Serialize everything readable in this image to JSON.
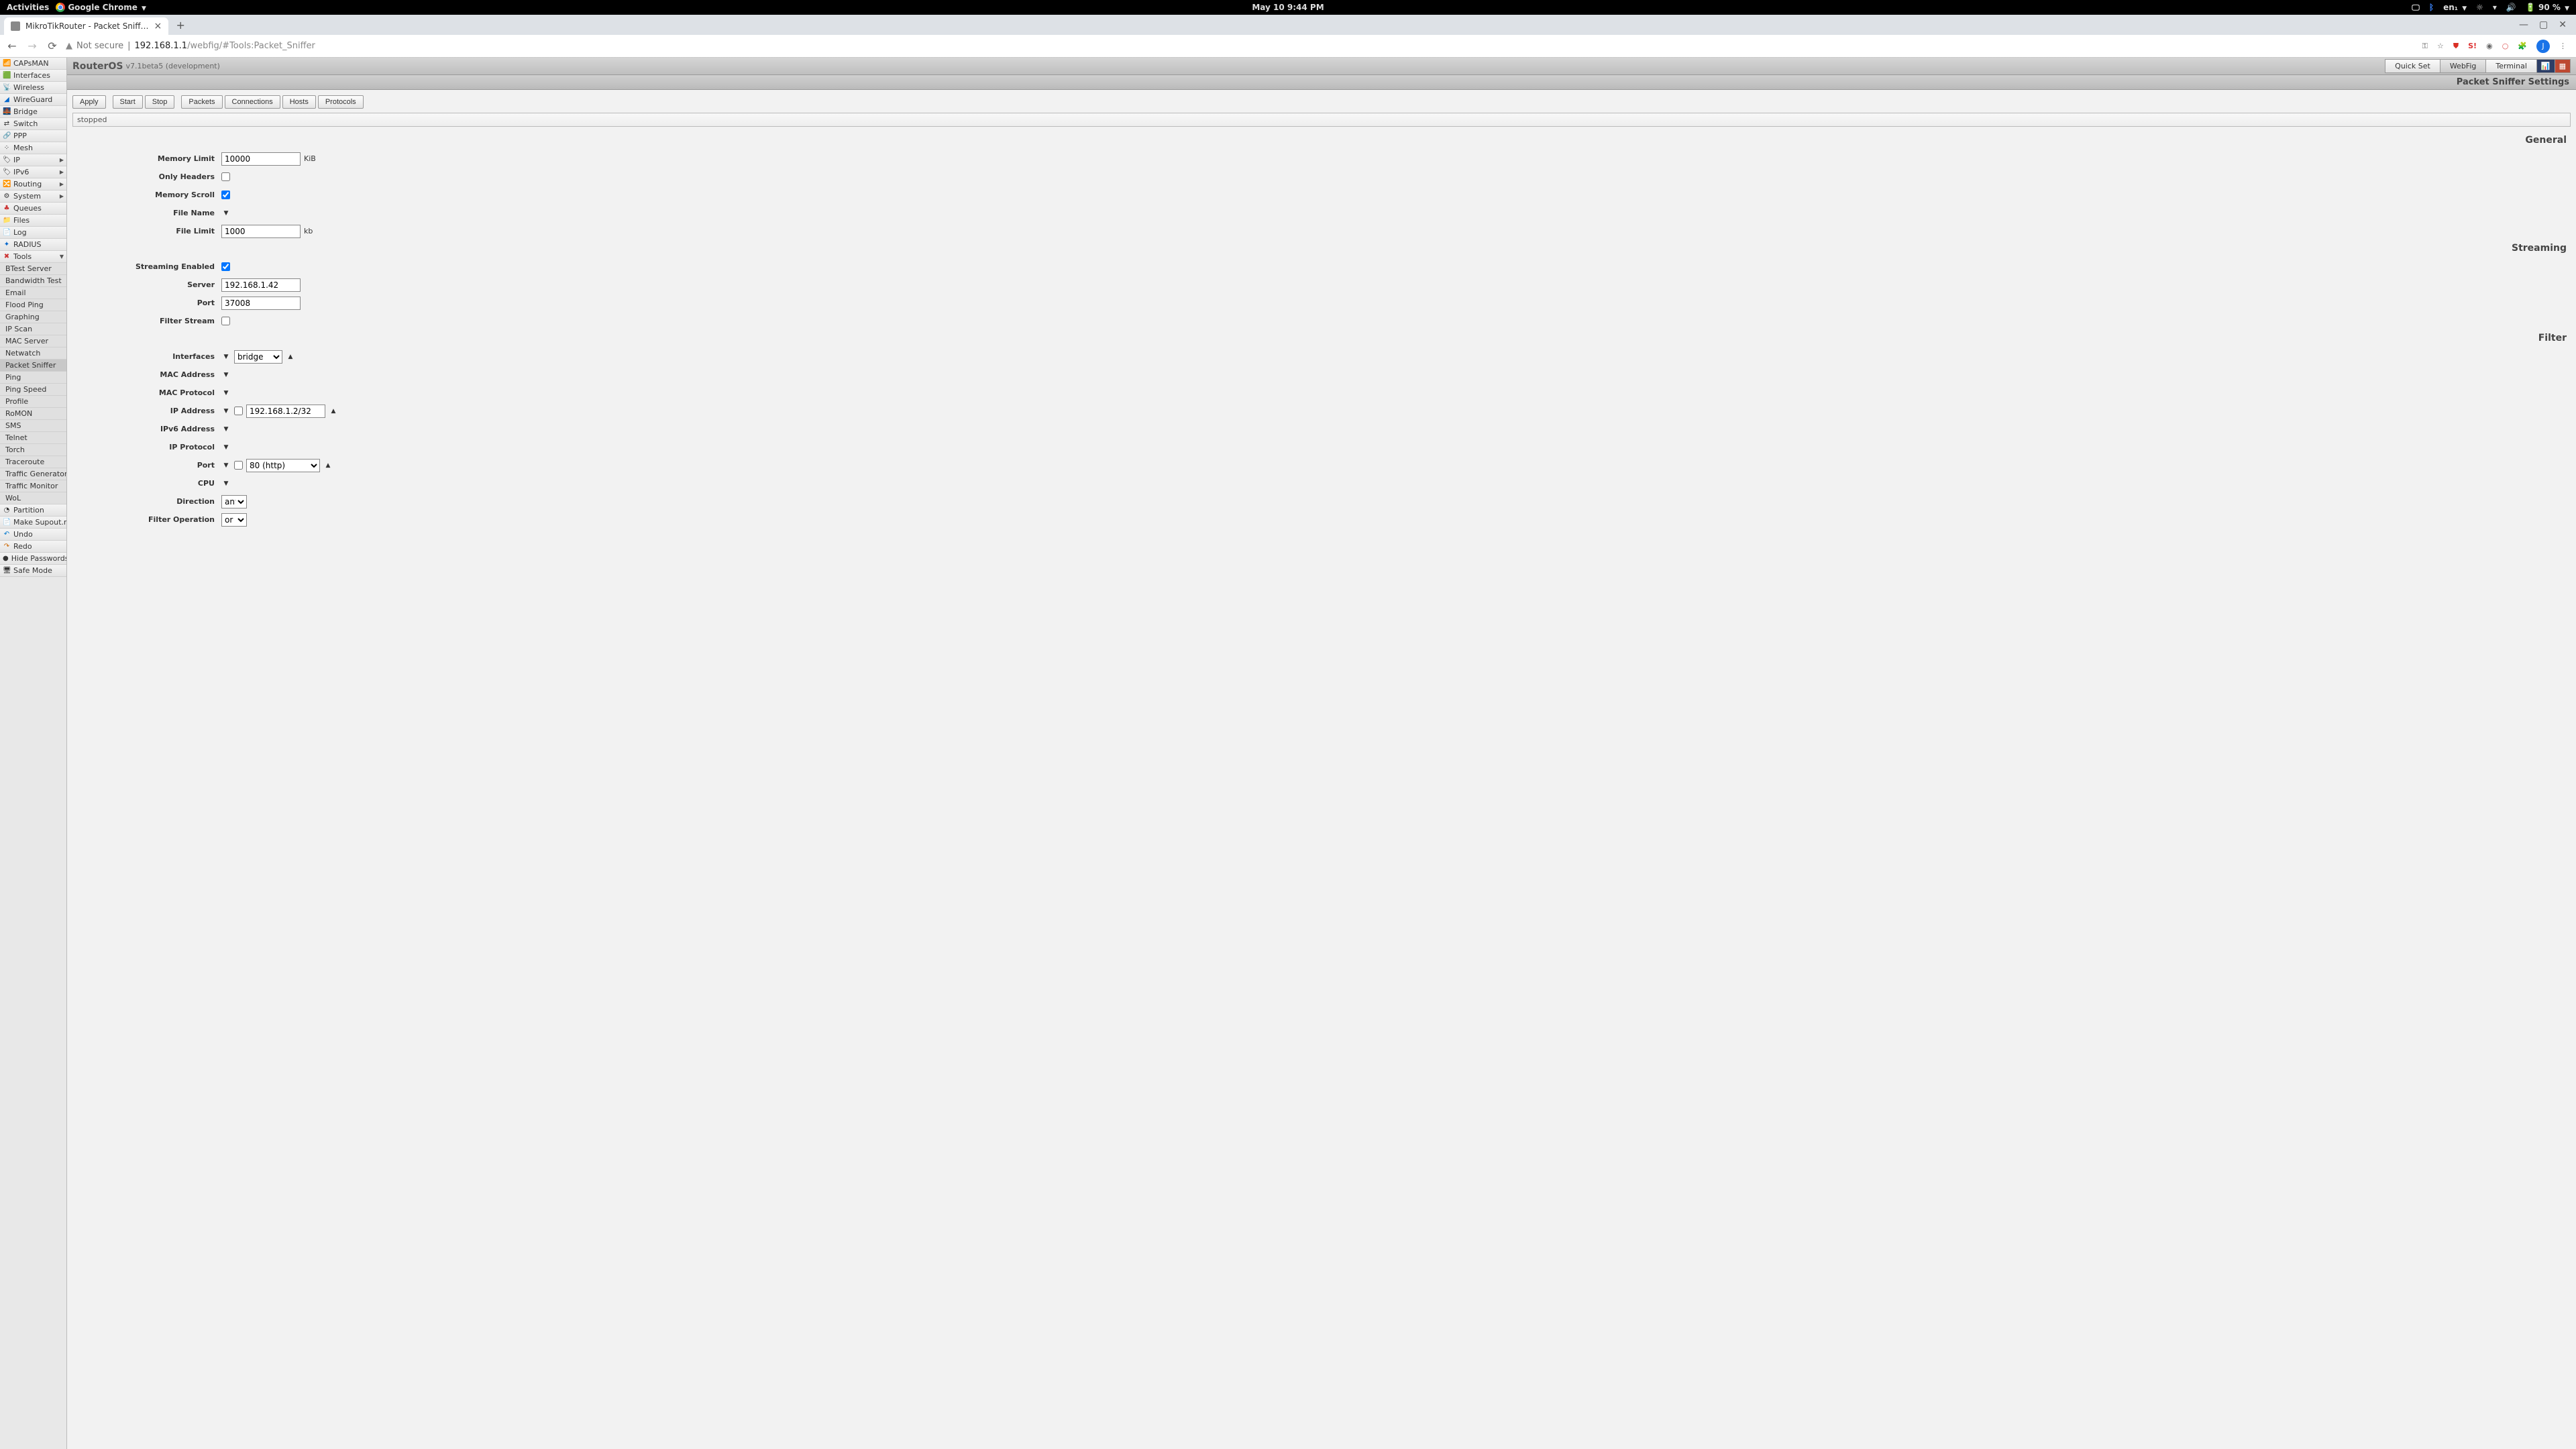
{
  "gnome": {
    "activities": "Activities",
    "app": "Google Chrome",
    "clock": "May 10  9:44 PM",
    "lang": "en₁",
    "battery": "90 %"
  },
  "browser": {
    "tab_title": "MikroTikRouter - Packet Sniff…",
    "not_secure": "Not secure",
    "host": "192.168.1.1",
    "path": "/webfig/#Tools:Packet_Sniffer"
  },
  "router": {
    "brand": "RouterOS",
    "version": "v7.1beta5 (development)",
    "tabs": {
      "quickset": "Quick Set",
      "webfig": "WebFig",
      "terminal": "Terminal"
    },
    "page_title": "Packet Sniffer Settings"
  },
  "sidebar": {
    "items": [
      "CAPsMAN",
      "Interfaces",
      "Wireless",
      "WireGuard",
      "Bridge",
      "Switch",
      "PPP",
      "Mesh",
      "IP",
      "IPv6",
      "Routing",
      "System",
      "Queues",
      "Files",
      "Log",
      "RADIUS",
      "Tools"
    ],
    "tools": [
      "BTest Server",
      "Bandwidth Test",
      "Email",
      "Flood Ping",
      "Graphing",
      "IP Scan",
      "MAC Server",
      "Netwatch",
      "Packet Sniffer",
      "Ping",
      "Ping Speed",
      "Profile",
      "RoMON",
      "SMS",
      "Telnet",
      "Torch",
      "Traceroute",
      "Traffic Generator",
      "Traffic Monitor",
      "WoL"
    ],
    "bottom": [
      "Partition",
      "Make Supout.rif",
      "Undo",
      "Redo",
      "Hide Passwords",
      "Safe Mode"
    ]
  },
  "toolbar": {
    "apply": "Apply",
    "start": "Start",
    "stop": "Stop",
    "packets": "Packets",
    "connections": "Connections",
    "hosts": "Hosts",
    "protocols": "Protocols"
  },
  "status": "stopped",
  "sections": {
    "general": "General",
    "streaming": "Streaming",
    "filter": "Filter"
  },
  "general": {
    "memory_limit_label": "Memory Limit",
    "memory_limit": "10000",
    "memory_limit_unit": "KiB",
    "only_headers_label": "Only Headers",
    "memory_scroll_label": "Memory Scroll",
    "file_name_label": "File Name",
    "file_limit_label": "File Limit",
    "file_limit": "1000",
    "file_limit_unit": "kb"
  },
  "streaming": {
    "enabled_label": "Streaming Enabled",
    "server_label": "Server",
    "server": "192.168.1.42",
    "port_label": "Port",
    "port": "37008",
    "filter_stream_label": "Filter Stream"
  },
  "filter": {
    "interfaces_label": "Interfaces",
    "interface": "bridge",
    "mac_address_label": "MAC Address",
    "mac_protocol_label": "MAC Protocol",
    "ip_address_label": "IP Address",
    "ip_address": "192.168.1.2/32",
    "ipv6_address_label": "IPv6 Address",
    "ip_protocol_label": "IP Protocol",
    "port_label": "Port",
    "port": "80 (http)",
    "cpu_label": "CPU",
    "direction_label": "Direction",
    "direction": "any",
    "operation_label": "Filter Operation",
    "operation": "or"
  }
}
